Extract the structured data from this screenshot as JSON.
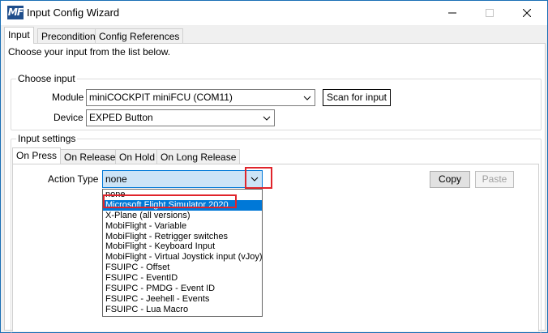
{
  "window": {
    "title": "Input Config Wizard",
    "app_icon_text": "MF"
  },
  "tabs": [
    {
      "label": "Input",
      "active": true
    },
    {
      "label": "Precondition",
      "active": false
    },
    {
      "label": "Config References",
      "active": false
    }
  ],
  "instruction": "Choose your input from the list below.",
  "choose_input": {
    "legend": "Choose input",
    "module_label": "Module",
    "module_value": "miniCOCKPIT miniFCU (COM11)",
    "device_label": "Device",
    "device_value": "EXPED Button",
    "scan_button": "Scan for input"
  },
  "input_settings": {
    "legend": "Input settings",
    "subtabs": [
      {
        "label": "On Press",
        "active": true
      },
      {
        "label": "On Release",
        "active": false
      },
      {
        "label": "On Hold",
        "active": false
      },
      {
        "label": "On Long Release",
        "active": false
      }
    ],
    "action_type_label": "Action Type",
    "action_type_value": "none",
    "copy_button": "Copy",
    "paste_button": "Paste",
    "options": [
      "none",
      "Microsoft Flight Simulator 2020",
      "X-Plane (all versions)",
      "MobiFlight - Variable",
      "MobiFlight - Retrigger switches",
      "MobiFlight - Keyboard Input",
      "MobiFlight - Virtual Joystick input (vJoy)",
      "FSUIPC - Offset",
      "FSUIPC - EventID",
      "FSUIPC - PMDG - Event ID",
      "FSUIPC - Jeehell - Events",
      "FSUIPC - Lua Macro"
    ],
    "selected_option_index": 1
  },
  "colors": {
    "accent": "#0078d7",
    "highlight_annotation": "#e0242b",
    "combo_focus_bg": "#cce4f7"
  }
}
